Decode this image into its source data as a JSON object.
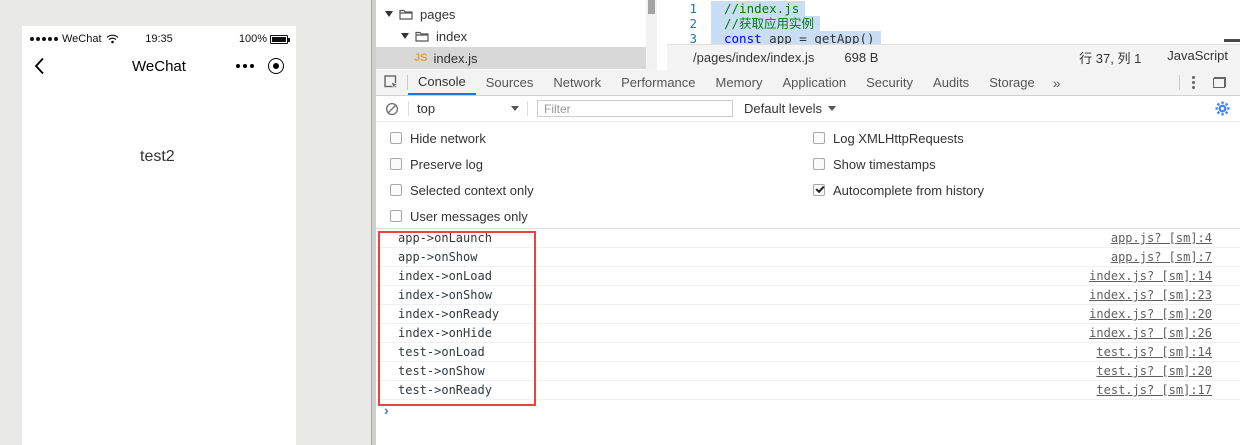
{
  "simulator": {
    "status_bar": {
      "carrier": "WeChat",
      "time": "19:35",
      "battery_pct": "100%"
    },
    "nav_bar": {
      "title": "WeChat"
    },
    "page_text": "test2"
  },
  "file_tree": {
    "items": [
      {
        "label": "pages"
      },
      {
        "label": "index"
      },
      {
        "label": "index.js",
        "badge": "JS",
        "selected": true
      }
    ]
  },
  "editor": {
    "lines": [
      {
        "num": "1",
        "comment": "//index.js"
      },
      {
        "num": "2",
        "comment": "//获取应用实例"
      },
      {
        "num": "3",
        "keyword": "const",
        "code": " app = getApp()"
      }
    ],
    "status_bar": {
      "path": "/pages/index/index.js",
      "size": "698 B",
      "cursor": "行 37, 列 1",
      "language": "JavaScript"
    }
  },
  "devtools": {
    "tabs": [
      {
        "label": "Console",
        "active": true
      },
      {
        "label": "Sources"
      },
      {
        "label": "Network"
      },
      {
        "label": "Performance"
      },
      {
        "label": "Memory"
      },
      {
        "label": "Application"
      },
      {
        "label": "Security"
      },
      {
        "label": "Audits"
      },
      {
        "label": "Storage"
      }
    ],
    "more_tabs_symbol": "»",
    "toolbar": {
      "context": "top",
      "filter_placeholder": "Filter",
      "levels_label": "Default levels"
    },
    "settings": {
      "left_column": [
        {
          "label": "Hide network",
          "checked": false
        },
        {
          "label": "Preserve log",
          "checked": false
        },
        {
          "label": "Selected context only",
          "checked": false
        },
        {
          "label": "User messages only",
          "checked": false
        }
      ],
      "right_column": [
        {
          "label": "Log XMLHttpRequests",
          "checked": false
        },
        {
          "label": "Show timestamps",
          "checked": false
        },
        {
          "label": "Autocomplete from history",
          "checked": true
        }
      ]
    },
    "console_logs": [
      {
        "message": "app->onLaunch",
        "source": "app.js? [sm]:4"
      },
      {
        "message": "app->onShow",
        "source": "app.js? [sm]:7"
      },
      {
        "message": "index->onLoad",
        "source": "index.js? [sm]:14"
      },
      {
        "message": "index->onShow",
        "source": "index.js? [sm]:23"
      },
      {
        "message": "index->onReady",
        "source": "index.js? [sm]:20"
      },
      {
        "message": "index->onHide",
        "source": "index.js? [sm]:26"
      },
      {
        "message": "test->onLoad",
        "source": "test.js? [sm]:14"
      },
      {
        "message": "test->onShow",
        "source": "test.js? [sm]:20"
      },
      {
        "message": "test->onReady",
        "source": "test.js? [sm]:17"
      }
    ],
    "prompt_symbol": "›"
  },
  "colors": {
    "accent_blue": "#1a73e8",
    "annotation_red": "#e8453c",
    "comment_green": "#008000",
    "keyword_blue": "#0000ff",
    "gear_blue": "#4285f4",
    "selection_blue": "#c9def5"
  }
}
